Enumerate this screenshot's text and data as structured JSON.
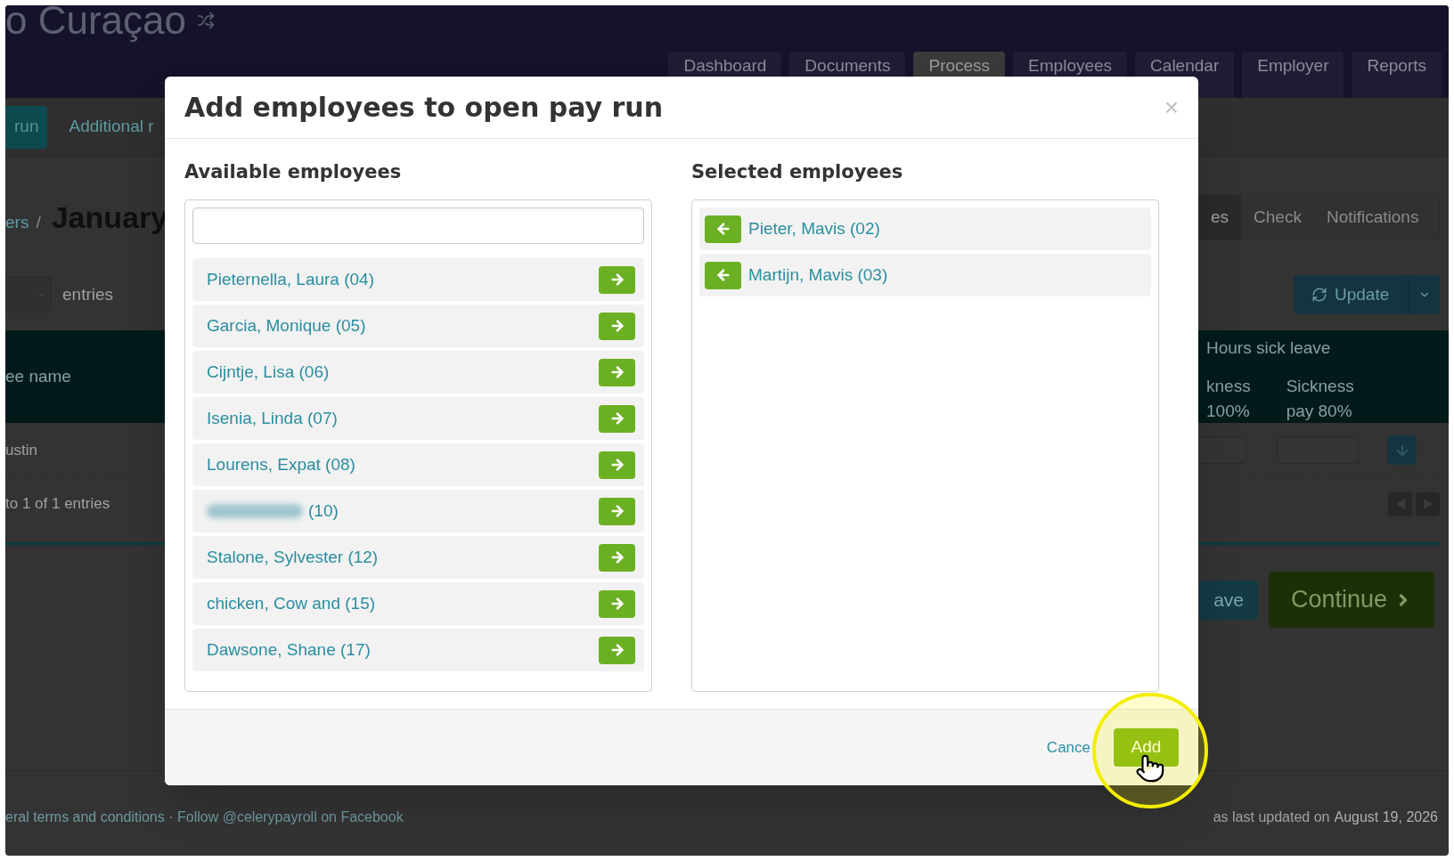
{
  "header": {
    "title": "o Curaçao",
    "nav": [
      {
        "label": "Dashboard",
        "selected": false
      },
      {
        "label": "Documents",
        "selected": false
      },
      {
        "label": "Process",
        "selected": true
      },
      {
        "label": "Employees",
        "selected": false
      },
      {
        "label": "Calendar",
        "selected": false
      },
      {
        "label": "Employer",
        "selected": false
      },
      {
        "label": "Reports",
        "selected": false
      }
    ]
  },
  "subnav": {
    "button": "run",
    "link": "Additional r"
  },
  "breadcrumb": {
    "parent": "ers",
    "separator": "/",
    "title": "January"
  },
  "steps": [
    {
      "label": "es",
      "selected": true
    },
    {
      "label": "Check",
      "selected": false
    },
    {
      "label": "Notifications",
      "selected": false
    }
  ],
  "entries_label": "entries",
  "update_button": "Update",
  "table": {
    "name_column": "ee name",
    "group_column": "Hours sick leave",
    "sub_columns": [
      "kness\n100%",
      "Sickness\npay 80%"
    ],
    "rows": [
      {
        "name": "ustin"
      }
    ],
    "info": "to 1 of 1 entries"
  },
  "save_button": "ave",
  "continue_button": "Continue",
  "footer": {
    "links": "eral terms and conditions · Follow @celerypayroll on Facebook",
    "updated": "as last updated on",
    "date": "August 19, 2026"
  },
  "modal": {
    "title": "Add employees to open pay run",
    "close": "×",
    "available": {
      "heading": "Available employees",
      "employees": [
        {
          "name": "Pieternella, Laura (04)",
          "redacted": false
        },
        {
          "name": "Garcia, Monique (05)",
          "redacted": false
        },
        {
          "name": "Cijntje, Lisa (06)",
          "redacted": false
        },
        {
          "name": "Isenia, Linda (07)",
          "redacted": false
        },
        {
          "name": "Lourens, Expat (08)",
          "redacted": false
        },
        {
          "name": "(10)",
          "redacted": true
        },
        {
          "name": "Stalone, Sylvester (12)",
          "redacted": false
        },
        {
          "name": "chicken, Cow and (15)",
          "redacted": false
        },
        {
          "name": "Dawsone, Shane (17)",
          "redacted": false
        }
      ]
    },
    "selected": {
      "heading": "Selected employees",
      "employees": [
        {
          "name": "Pieter, Mavis (02)"
        },
        {
          "name": "Martijn, Mavis (03)"
        }
      ]
    },
    "cancel": "Cance",
    "add": "Add"
  }
}
